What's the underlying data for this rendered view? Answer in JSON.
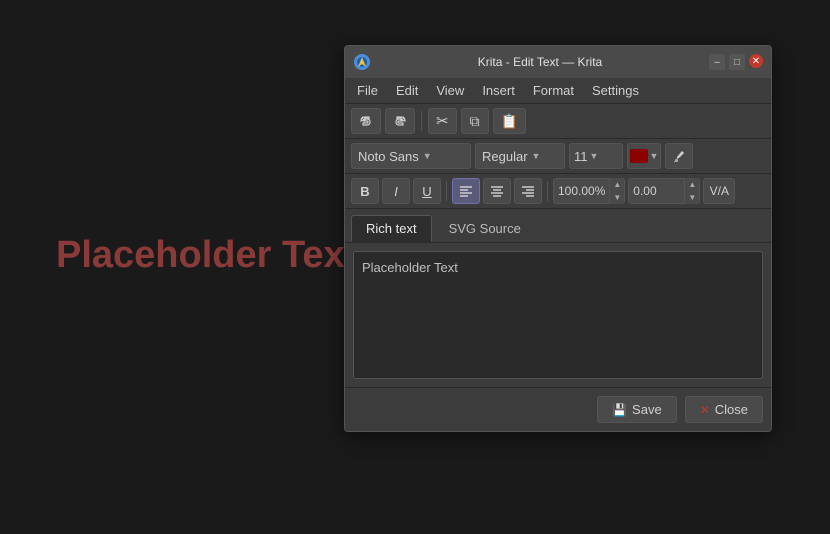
{
  "canvas": {
    "placeholder_text": "Placeholder Text"
  },
  "dialog": {
    "title": "Krita - Edit Text — Krita",
    "menu": {
      "items": [
        "File",
        "Edit",
        "View",
        "Insert",
        "Format",
        "Settings"
      ]
    },
    "toolbar1": {
      "undo_label": "↩",
      "redo_label": "↪",
      "cut_label": "✂",
      "copy_label": "⧉",
      "paste_label": "📋"
    },
    "font_toolbar": {
      "font_name": "Noto Sans",
      "font_style": "Regular",
      "font_size": "11",
      "color_hex": "#8b0000"
    },
    "format_toolbar": {
      "bold_label": "B",
      "italic_label": "I",
      "underline_label": "U",
      "align_left_label": "≡",
      "align_center_label": "≡",
      "align_right_label": "≡",
      "line_spacing_value": "100.00%",
      "char_spacing_value": "0.00",
      "kern_label": "V/A"
    },
    "tabs": {
      "items": [
        "Rich text",
        "SVG Source"
      ],
      "active": 0
    },
    "editor": {
      "content": "Placeholder Text"
    },
    "footer": {
      "save_label": "Save",
      "close_label": "Close"
    }
  }
}
